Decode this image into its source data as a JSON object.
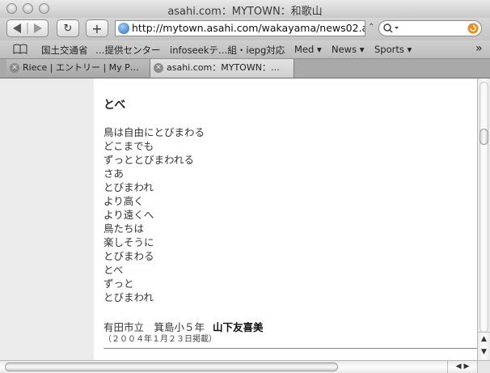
{
  "window": {
    "title": "asahi.com：MYTOWN：和歌山"
  },
  "toolbar": {
    "back_icon": "back-arrow-icon",
    "forward_icon": "forward-arrow-icon",
    "reload_glyph": "↻",
    "add_glyph": "+",
    "url": "http://mytown.asahi.com/wakayama/news02.asp",
    "url_arrow": "⌃",
    "search_value": ""
  },
  "bookmarks": {
    "items": [
      "国土交通省",
      "…提供センター",
      "infoseekテ…組・iepg対応",
      "Med ▾",
      "News ▾",
      "Sports ▾"
    ],
    "overflow": "»"
  },
  "tabs": [
    {
      "label": "Riece | エントリー | My P…"
    },
    {
      "label": "asahi.com：MYTOWN：…"
    }
  ],
  "article": {
    "title": "とべ",
    "lines": [
      "鳥は自由にとびまわる",
      "どこまでも",
      "ずっととびまわれる",
      "さあ",
      "とびまわれ",
      "より高く",
      "より遠くへ",
      "鳥たちは",
      "楽しそうに",
      "とびまわる",
      "とべ",
      "ずっと",
      "とびまわれ"
    ],
    "school": "有田市立　箕島小５年",
    "author": "山下友喜美",
    "date": "（２００４年１月２３日掲載）"
  },
  "scrollbars": {
    "up_glyph": "▲",
    "down_glyph": "▼",
    "left_glyph": "◀",
    "right_glyph": "▶"
  }
}
